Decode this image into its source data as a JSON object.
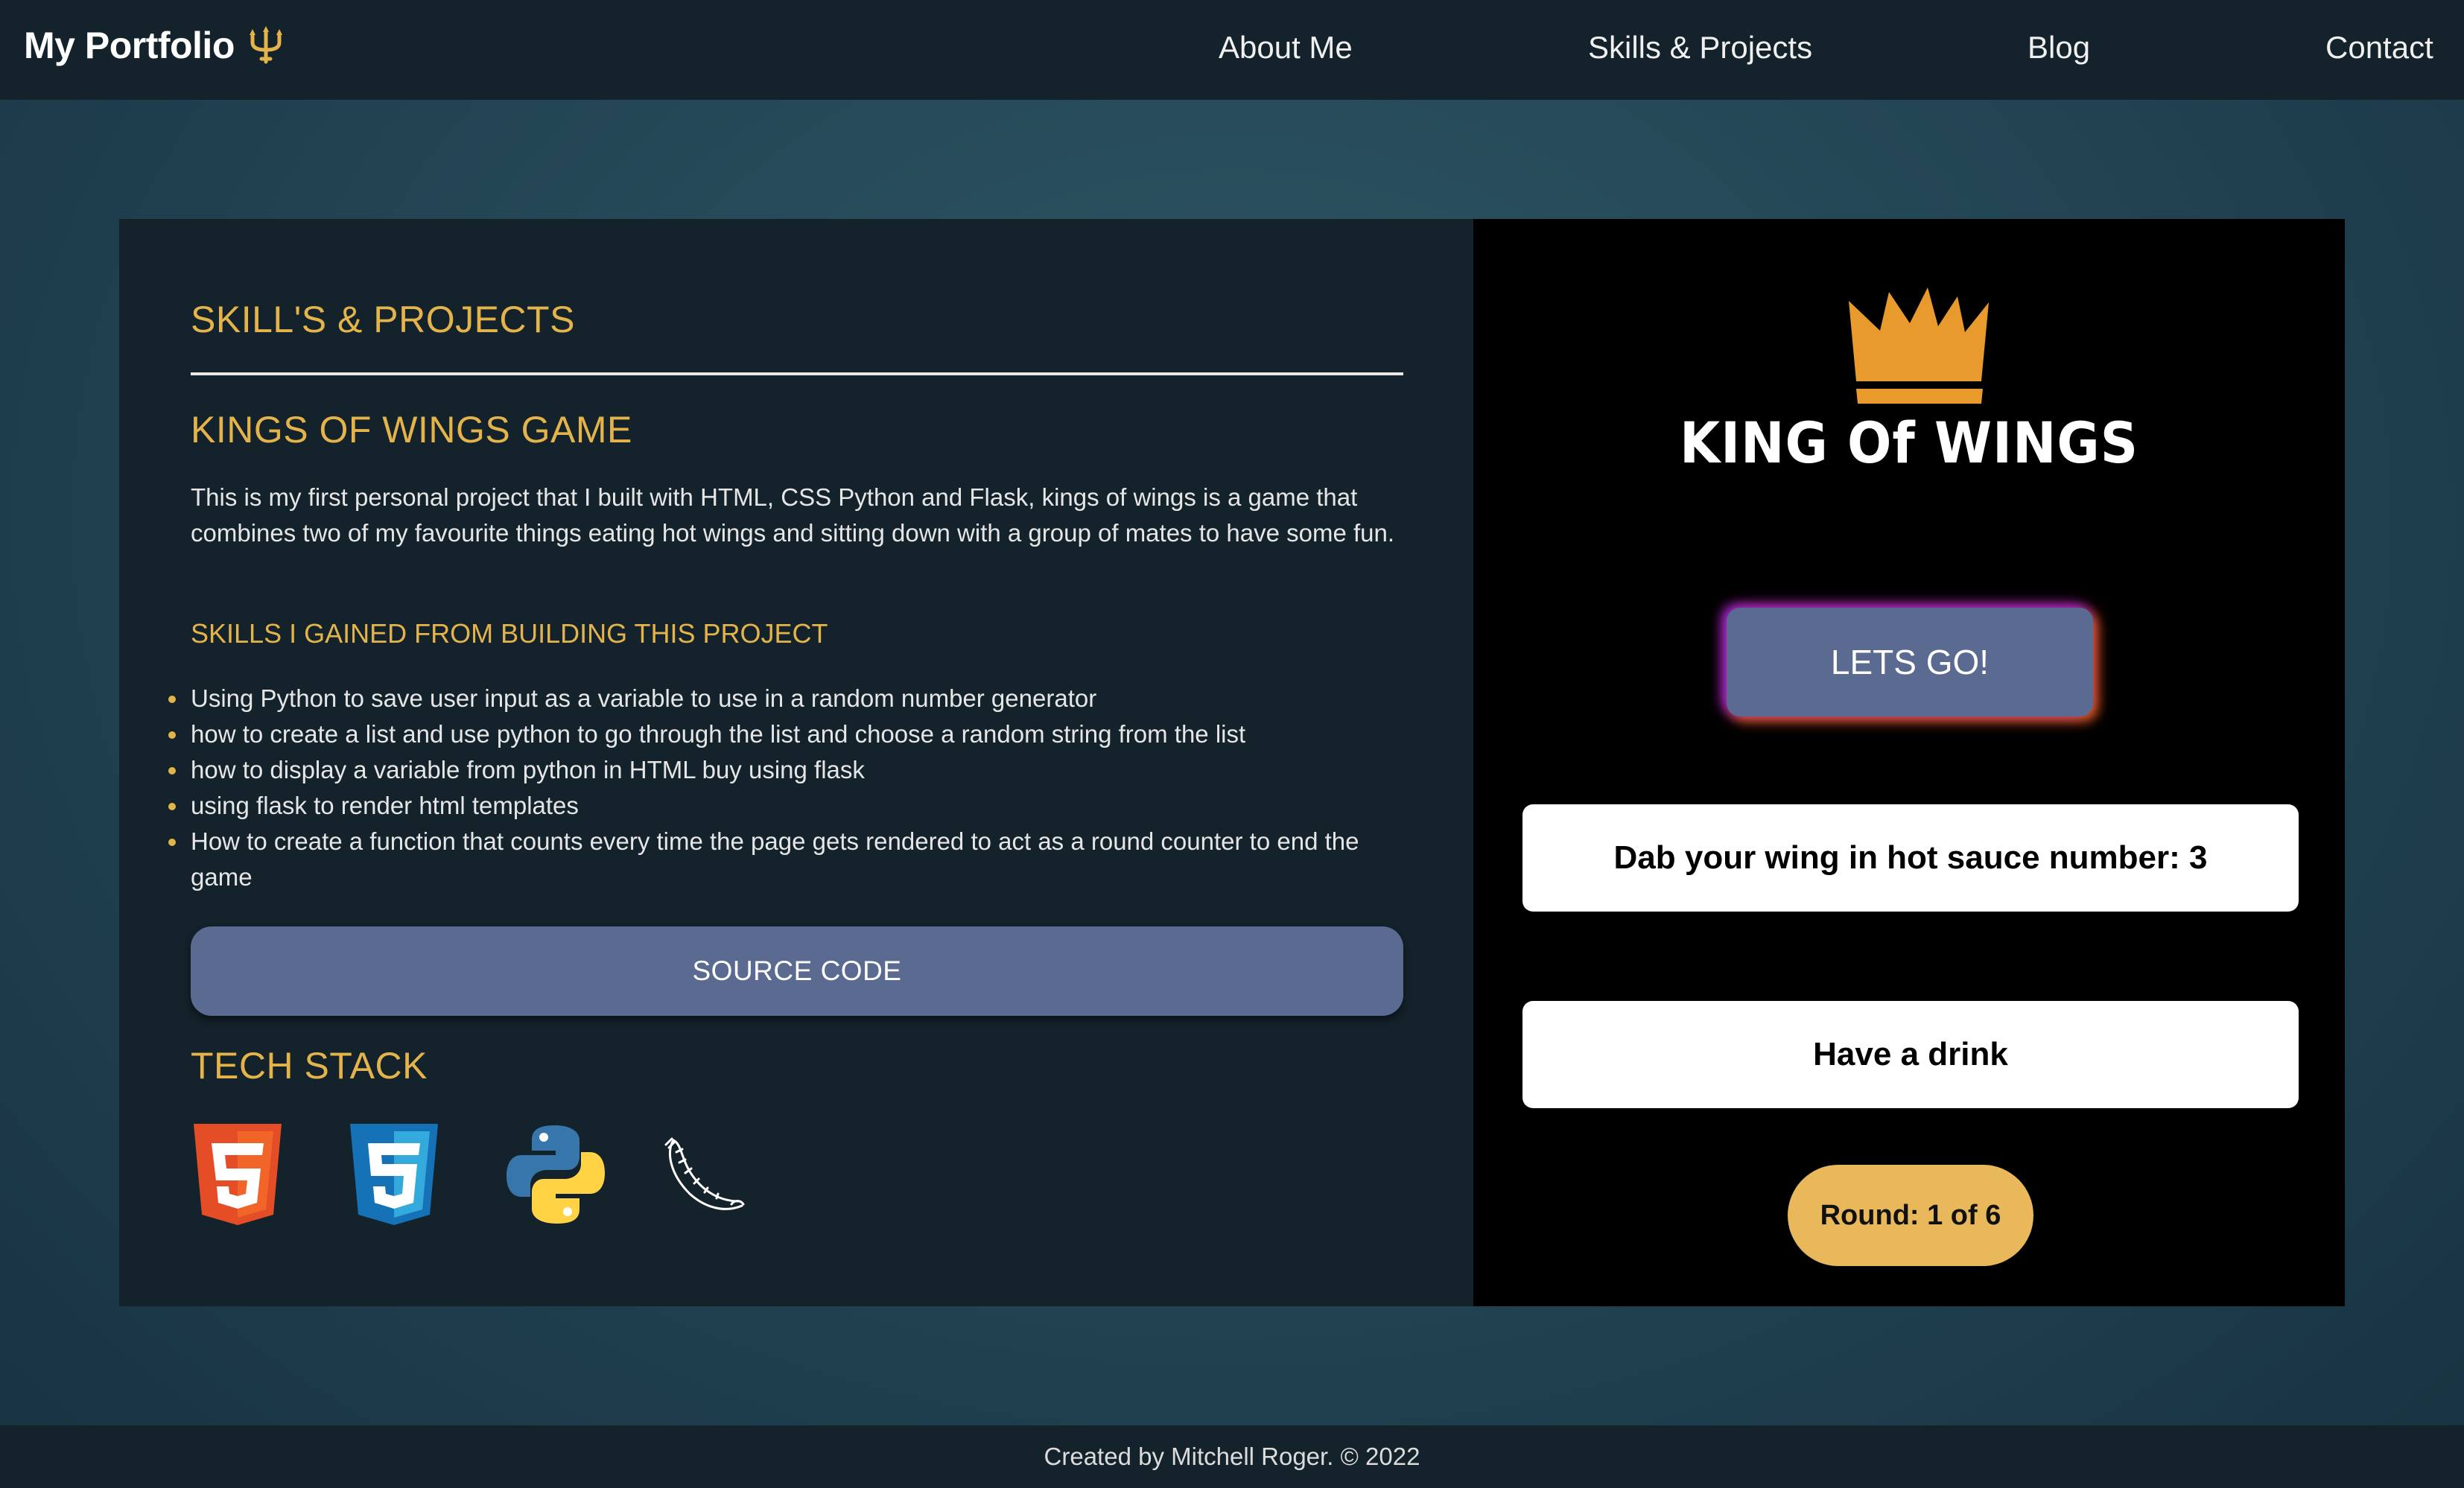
{
  "nav": {
    "brand": "My Portfolio",
    "brand_icon": "trident-icon",
    "links": [
      "About Me",
      "Skills & Projects",
      "Blog",
      "Contact"
    ]
  },
  "project": {
    "section_title": "SKILL'S & PROJECTS",
    "project_title": "KINGS OF WINGS GAME",
    "description": "This is my first personal project that I built with HTML, CSS Python and Flask, kings of wings is a game that combines two of my favourite things eating hot wings and sitting down with a group of mates to have some fun.",
    "skills_title": "SKILLS I GAINED FROM BUILDING THIS PROJECT",
    "skills": [
      "Using Python to save user input as a variable to use in a random number generator",
      "how to create a list and use python to go through the list and choose a random string from the list",
      "how to display a variable from python in HTML buy using flask",
      "using flask to render html templates",
      "How to create a function that counts every time the page gets rendered to act as a round counter to end the game"
    ],
    "source_button": "SOURCE CODE",
    "tech_title": "TECH STACK",
    "tech_icons": [
      "html5-icon",
      "css3-icon",
      "python-icon",
      "flask-icon"
    ]
  },
  "game": {
    "logo_text": "KING Of WINGS",
    "lets_go": "LETS GO!",
    "result_1": "Dab your wing in hot sauce number: 3",
    "result_2": "Have a drink",
    "round": "Round: 1 of 6"
  },
  "footer": {
    "text": "Created by Mitchell Roger. © 2022"
  },
  "colors": {
    "accent_gold": "#e4b44b",
    "button_blue": "#5a6a91",
    "panel_dark": "#13222b",
    "round_pill": "#e8b85a"
  }
}
